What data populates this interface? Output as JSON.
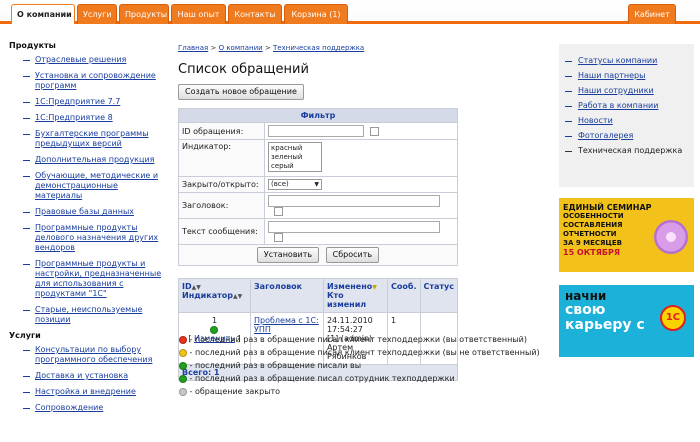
{
  "nav": {
    "tabs": [
      "О компании",
      "Услуги",
      "Продукты",
      "Наш опыт",
      "Контакты",
      "Корзина (1)"
    ],
    "cabinet": "Кабинет"
  },
  "left": {
    "products_title": "Продукты",
    "products": [
      "Отраслевые решения",
      "Установка и сопровождение программ",
      "1С:Предприятие 7.7",
      "1С:Предприятие 8",
      "Бухгалтерские программы предыдущих версий",
      "Дополнительная продукция",
      "Обучающие, методические и демонстрационные материалы",
      "Правовые базы данных",
      "Программные продукты делового назначения других вендоров",
      "Программные продукты и настройки, предназначенные для использования с продуктами \"1С\"",
      "Старые, неиспользуемые позиции"
    ],
    "services_title": "Услуги",
    "services": [
      "Консультации по выбору программного обеспечения",
      "Доставка и установка",
      "Настройка и внедрение",
      "Сопровождение"
    ]
  },
  "breadcrumb": {
    "home": "Главная",
    "sep": ">",
    "about": "О компании",
    "support": "Техническая поддержка"
  },
  "page_title": "Список обращений",
  "create_button": "Создать новое обращение",
  "filter": {
    "title": "Фильтр",
    "id_label": "ID обращения:",
    "indicator_label": "Индикатор:",
    "indicator_options": [
      "красный",
      "зеленый",
      "серый"
    ],
    "closed_label": "Закрыто/открыто:",
    "closed_value": "(все)",
    "subject_label": "Заголовок:",
    "message_label": "Текст сообщения:",
    "set_button": "Установить",
    "reset_button": "Сбросить"
  },
  "results": {
    "headers": {
      "id": "ID",
      "indicator": "Индикатор",
      "subject": "Заголовок",
      "changed": "Изменено",
      "changed_by": "Кто изменил",
      "count": "Сооб.",
      "status": "Статус"
    },
    "rows": [
      {
        "id": "1",
        "edit": "Изменить",
        "subject": "Проблема с 1С: УПП",
        "changed": "24.11.2010 17:54:27",
        "changed_by": "[1] (admin) Артем Рябинков",
        "count": "1",
        "status": "",
        "indicator_color": "#22a022"
      }
    ],
    "total": "Всего: 1"
  },
  "legend": [
    {
      "color": "#e8321e",
      "text": "- последний раз в обращение писал клиент техподдержки (вы ответственный)"
    },
    {
      "color": "#f0c419",
      "text": "- последний раз в обращение писал клиент техподдержки (вы не ответственный)"
    },
    {
      "color": "#22a022",
      "text": "- последний раз в обращение писали вы"
    },
    {
      "color": "#22a022",
      "text": "- последний раз в обращение писал сотрудник техподдержки"
    },
    {
      "color": "#c8c8c8",
      "text": "- обращение закрыто"
    }
  ],
  "right": {
    "items": [
      "Статусы компании",
      "Наши партнеры",
      "Наши сотрудники",
      "Работа в компании",
      "Новости",
      "Фотогалерея",
      "Техническая поддержка"
    ]
  },
  "ad1": {
    "lines": [
      "ЕДИНЫЙ СЕМИНАР",
      "ОСОБЕННОСТИ",
      "СОСТАВЛЕНИЯ",
      "ОТЧЕТНОСТИ",
      "ЗА 9 МЕСЯЦЕВ",
      "15 ОКТЯБРЯ"
    ]
  },
  "ad2": {
    "lines": [
      "начни",
      "свою",
      "карьеру с"
    ],
    "logo": "1С"
  },
  "colors": {
    "accent": "#f26a10",
    "link": "#1a3e9e"
  }
}
